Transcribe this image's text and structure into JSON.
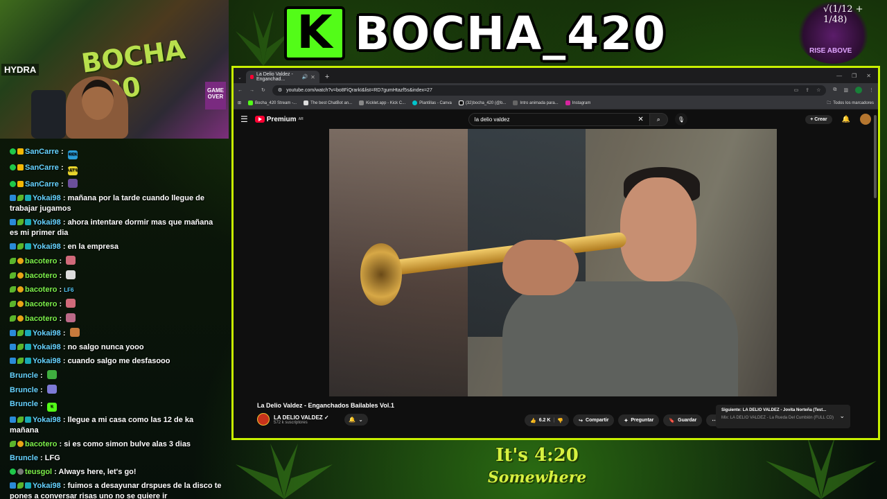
{
  "stream": {
    "channel_title": "BOCHA_420",
    "kick_logo_letter": "K",
    "corner_formula": "√(1/12 + 1/48)",
    "corner_caption": "RISE ABOVE",
    "webcam_wall_text": "BOCHA 420",
    "webcam_hydra": "HYDRA",
    "webcam_gameover": "GAME OVER",
    "footer_logo_line1": "It's 4:20",
    "footer_logo_line2": "Somewhere"
  },
  "chat": [
    {
      "badges": [
        "green",
        "crown"
      ],
      "user": "SanCarre",
      "ucls": "u-cyan",
      "text": "",
      "emote": "#2a9cd8",
      "emote_label": "KICK"
    },
    {
      "badges": [
        "green",
        "crown"
      ],
      "user": "SanCarre",
      "ucls": "u-cyan",
      "text": "",
      "emote": "#e9d52c",
      "emote_label": "LET'S"
    },
    {
      "badges": [
        "green",
        "crown"
      ],
      "user": "SanCarre",
      "ucls": "u-cyan",
      "text": "",
      "emote": "#6b4f9a",
      "emote_label": ""
    },
    {
      "badges": [
        "blue",
        "leaf",
        "teal"
      ],
      "user": "Yokai98",
      "ucls": "u-cyan",
      "text": "mañana por la tarde cuando llegue de trabajar jugamos"
    },
    {
      "badges": [
        "blue",
        "leaf",
        "teal"
      ],
      "user": "Yokai98",
      "ucls": "u-cyan",
      "text": "ahora intentare dormir mas que mañana es mi primer dia"
    },
    {
      "badges": [
        "blue",
        "leaf",
        "teal"
      ],
      "user": "Yokai98",
      "ucls": "u-cyan",
      "text": "en la empresa"
    },
    {
      "badges": [
        "leaf",
        "gold"
      ],
      "user": "bacotero",
      "ucls": "u-green",
      "text": "",
      "emote": "#d06a7a",
      "emote_label": ""
    },
    {
      "badges": [
        "leaf",
        "gold"
      ],
      "user": "bacotero",
      "ucls": "u-green",
      "text": "",
      "emote": "#dddddd",
      "emote_label": ""
    },
    {
      "badges": [
        "leaf",
        "gold"
      ],
      "user": "bacotero",
      "ucls": "u-green",
      "text": "",
      "emote": "",
      "emote_label": "LF6"
    },
    {
      "badges": [
        "leaf",
        "gold"
      ],
      "user": "bacotero",
      "ucls": "u-green",
      "text": "",
      "emote": "#d06a7a",
      "emote_label": ""
    },
    {
      "badges": [
        "leaf",
        "gold"
      ],
      "user": "bacotero",
      "ucls": "u-green",
      "text": "",
      "emote": "#bb6a88",
      "emote_label": ""
    },
    {
      "badges": [
        "blue",
        "leaf",
        "teal"
      ],
      "user": "Yokai98",
      "ucls": "u-cyan",
      "text": "",
      "emote": "#c77a3c",
      "emote_label": ""
    },
    {
      "badges": [
        "blue",
        "leaf",
        "teal"
      ],
      "user": "Yokai98",
      "ucls": "u-cyan",
      "text": "no salgo nunca yooo"
    },
    {
      "badges": [
        "blue",
        "leaf",
        "teal"
      ],
      "user": "Yokai98",
      "ucls": "u-cyan",
      "text": "cuando salgo me desfasooo"
    },
    {
      "badges": [],
      "user": "Bruncle",
      "ucls": "u-cyan",
      "text": "",
      "emote": "#3fae3f",
      "emote_label": ""
    },
    {
      "badges": [],
      "user": "Bruncle",
      "ucls": "u-cyan",
      "text": "",
      "emote": "#7d7ad6",
      "emote_label": ""
    },
    {
      "badges": [],
      "user": "Bruncle",
      "ucls": "u-cyan",
      "text": "",
      "emote": "#53fc18",
      "emote_label": "K"
    },
    {
      "badges": [
        "blue",
        "leaf",
        "teal"
      ],
      "user": "Yokai98",
      "ucls": "u-cyan",
      "text": "llegue a mi casa como las 12 de ka mañana"
    },
    {
      "badges": [
        "leaf",
        "gold"
      ],
      "user": "bacotero",
      "ucls": "u-green",
      "text": "si es como simon bulve alas 3 dias"
    },
    {
      "badges": [],
      "user": "Bruncle",
      "ucls": "u-cyan",
      "text": "LFG"
    },
    {
      "badges": [
        "green",
        "gray"
      ],
      "user": "teusgol",
      "ucls": "u-green",
      "text": "Always here, let's go!"
    },
    {
      "badges": [
        "blue",
        "leaf",
        "teal"
      ],
      "user": "Yokai98",
      "ucls": "u-cyan",
      "text": "fuimos a desayunar drspues de la disco te pones a conversar risas uno no se quiere ir"
    }
  ],
  "browser": {
    "tab_title": "La Delio Valdez - Enganchad...",
    "url": "youtube.com/watch?v=bo8FiQrarkI&list=RD7gumHtazf5s&index=27",
    "bookmarks": [
      "Bocha_420 Stream -...",
      "The best ChatBot an...",
      "Kicklet.app - Kick C...",
      "Plantillas - Canva",
      "(32)bocha_420 (@b...",
      "Intro animada para...",
      "Instagram"
    ],
    "bookmarks_right": "Todos los marcadores"
  },
  "youtube": {
    "logo_text": "Premium",
    "region": "AR",
    "search_value": "la delio valdez",
    "create_label": "+ Crear",
    "video_title": "La Delio Valdez - Enganchados Bailables Vol.1",
    "channel_name": "LA DELIO VALDEZ",
    "subscribers": "572 k suscriptores",
    "likes": "6.2 K",
    "share_label": "Compartir",
    "ask_label": "Preguntar",
    "save_label": "Guardar",
    "next_prefix": "Siguiente:",
    "next_title": "LA DELIO VALDEZ - Jovita Norteña (Test...",
    "next_mix": "Mix: LA DELIO VALDEZ - La Rueda Del Cumbión (FULL CD)"
  }
}
